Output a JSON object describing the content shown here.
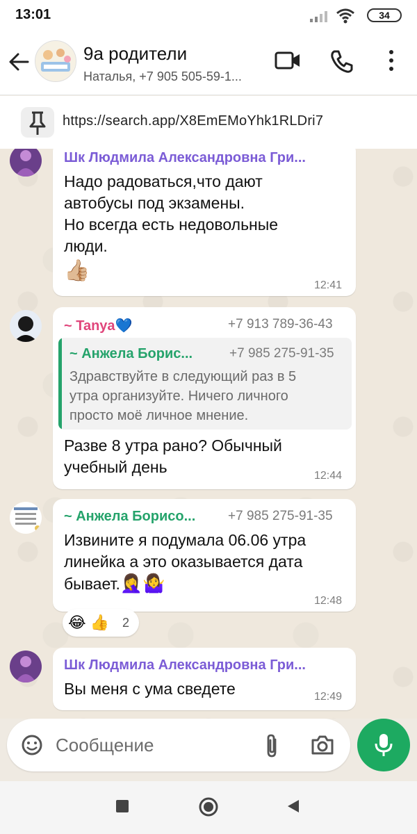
{
  "status_bar": {
    "time": "13:01",
    "battery": "34"
  },
  "header": {
    "title": "9а родители",
    "subtitle": "Наталья, +7 905 505-59-1..."
  },
  "pinned": {
    "text": "https://search.app/X8EmEMoYhk1RLDri7"
  },
  "messages": [
    {
      "sender": "Шк Людмила Александровна Гри...",
      "text_lines": [
        "Надо радоваться,что дают",
        "автобусы под экзамены.",
        "Но всегда есть недовольные",
        "люди."
      ],
      "emoji": "👍🏼",
      "time": "12:41"
    },
    {
      "sender": "~ Tanya💙",
      "phone": "+7 913 789-36-43",
      "quote": {
        "sender": "~ Анжела Борис...",
        "phone": "+7 985 275-91-35",
        "lines": [
          "Здравствуйте в следующий раз в 5",
          "утра организуйте. Ничего личного",
          "просто моё личное мнение."
        ]
      },
      "text_lines": [
        "Разве 8 утра рано? Обычный",
        "учебный день"
      ],
      "time": "12:44"
    },
    {
      "sender": "~ Анжела Борисо...",
      "phone": "+7 985 275-91-35",
      "text_lines": [
        "Извините я подумала 06.06 утра",
        "линейка а это оказывается дата",
        "бывает."
      ],
      "emoji": "🤦‍♀️🤷‍♀️",
      "time": "12:48",
      "reactions": {
        "emojis": "😂 👍",
        "count": "2"
      }
    },
    {
      "sender": "Шк Людмила Александровна Гри...",
      "text_lines": [
        "Вы меня с ума сведете"
      ],
      "time": "12:49"
    }
  ],
  "input": {
    "placeholder": "Сообщение"
  },
  "colors": {
    "accent_green": "#1daa61",
    "sender_purple": "#7b5cd6",
    "sender_pink": "#e0457b",
    "sender_green": "#25a36b",
    "quote_bar": "#25a36b"
  },
  "icons": [
    "back-arrow-icon",
    "video-call-icon",
    "phone-call-icon",
    "more-vert-icon",
    "pin-icon",
    "emoji-icon",
    "attach-icon",
    "camera-icon",
    "mic-icon",
    "nav-square-icon",
    "nav-circle-icon",
    "nav-back-icon"
  ]
}
